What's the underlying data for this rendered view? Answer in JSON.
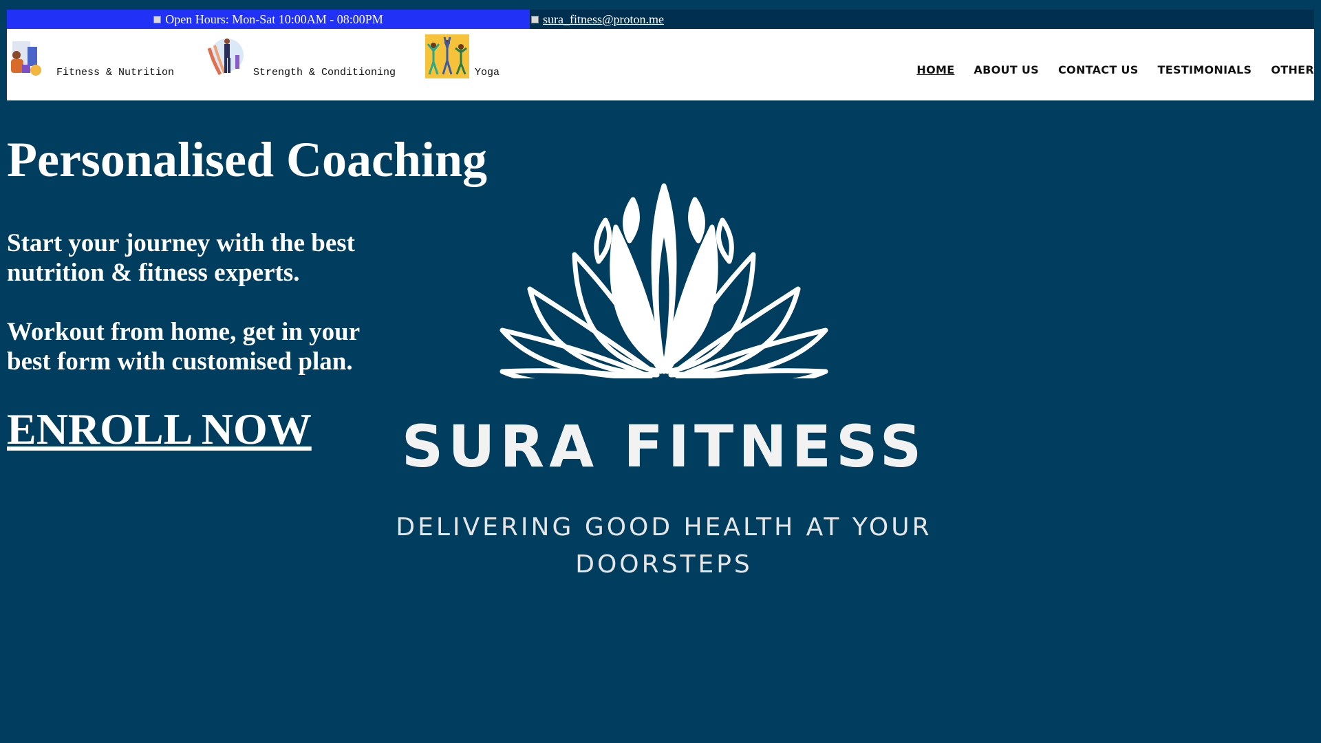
{
  "topbar": {
    "hours_text": "Open Hours: Mon-Sat 10:00AM - 08:00PM",
    "email": "sura_fitness@proton.me",
    "hours_bg": "#2131f5",
    "bar_bg": "#012f4f"
  },
  "categories": [
    {
      "label": "Fitness & Nutrition",
      "icon": "fitness-nutrition-icon"
    },
    {
      "label": "Strength & Conditioning",
      "icon": "strength-conditioning-icon"
    },
    {
      "label": "Yoga",
      "icon": "yoga-icon"
    }
  ],
  "nav": {
    "home": "HOME",
    "about": "ABOUT US",
    "contact": "CONTACT US",
    "testimonials": "TESTIMONIALS",
    "other": "OTHER"
  },
  "hero": {
    "title": "Personalised Coaching",
    "line1": "Start your journey with the best nutrition & fitness experts.",
    "line2": "Workout from home, get in your best form with customised plan.",
    "cta": "ENROLL NOW"
  },
  "brand": {
    "name": "SURA FITNESS",
    "tagline_1": "DELIVERING GOOD HEALTH AT YOUR",
    "tagline_2": "DOORSTEPS",
    "bg_color": "#003d5f"
  }
}
